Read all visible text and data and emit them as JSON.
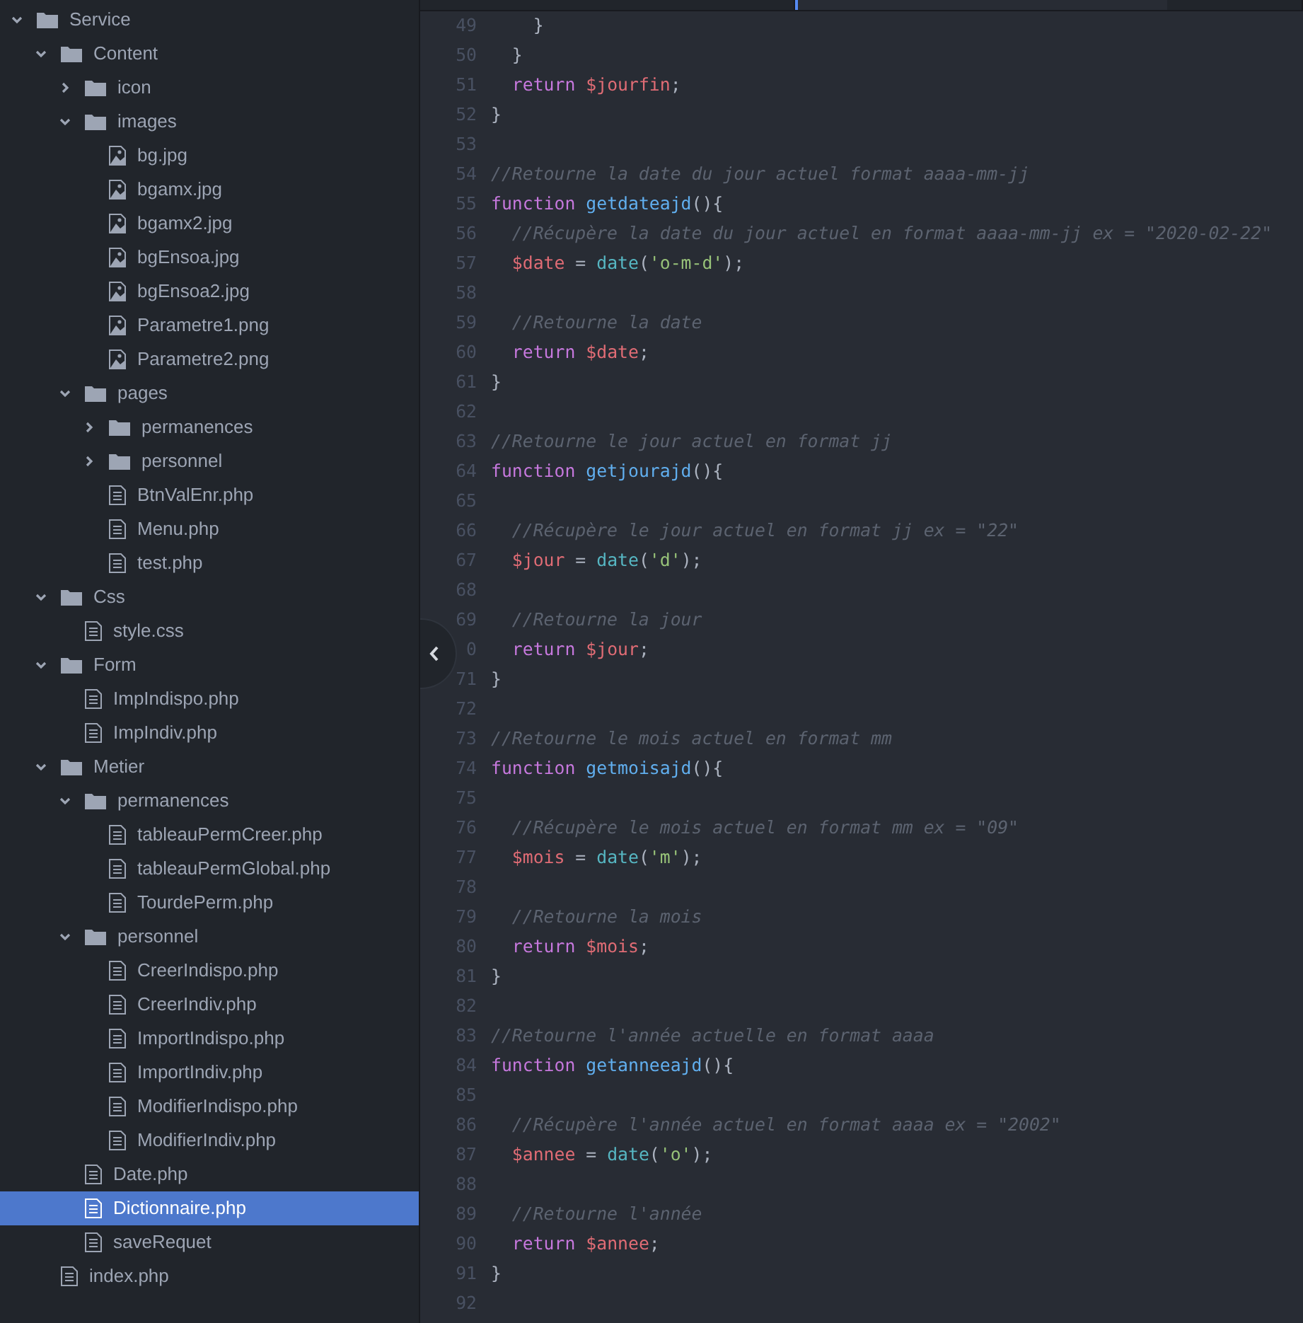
{
  "tabs": [
    {
      "selected": false
    },
    {
      "selected": true
    },
    {
      "selected": false
    }
  ],
  "tree": [
    {
      "kind": "folder",
      "name": "Service",
      "expanded": true,
      "selected": false,
      "children": [
        {
          "kind": "folder",
          "name": "Content",
          "expanded": true,
          "selected": false,
          "children": [
            {
              "kind": "folder",
              "name": "icon",
              "expanded": false,
              "selected": false
            },
            {
              "kind": "folder",
              "name": "images",
              "expanded": true,
              "selected": false,
              "children": [
                {
                  "kind": "image",
                  "name": "bg.jpg",
                  "selected": false
                },
                {
                  "kind": "image",
                  "name": "bgamx.jpg",
                  "selected": false
                },
                {
                  "kind": "image",
                  "name": "bgamx2.jpg",
                  "selected": false
                },
                {
                  "kind": "image",
                  "name": "bgEnsoa.jpg",
                  "selected": false
                },
                {
                  "kind": "image",
                  "name": "bgEnsoa2.jpg",
                  "selected": false
                },
                {
                  "kind": "image",
                  "name": "Parametre1.png",
                  "selected": false
                },
                {
                  "kind": "image",
                  "name": "Parametre2.png",
                  "selected": false
                }
              ]
            },
            {
              "kind": "folder",
              "name": "pages",
              "expanded": true,
              "selected": false,
              "children": [
                {
                  "kind": "folder",
                  "name": "permanences",
                  "expanded": false,
                  "selected": false
                },
                {
                  "kind": "folder",
                  "name": "personnel",
                  "expanded": false,
                  "selected": false
                },
                {
                  "kind": "file",
                  "name": "BtnValEnr.php",
                  "selected": false
                },
                {
                  "kind": "file",
                  "name": "Menu.php",
                  "selected": false
                },
                {
                  "kind": "file",
                  "name": "test.php",
                  "selected": false
                }
              ]
            }
          ]
        },
        {
          "kind": "folder",
          "name": "Css",
          "expanded": true,
          "selected": false,
          "children": [
            {
              "kind": "file",
              "name": "style.css",
              "selected": false
            }
          ]
        },
        {
          "kind": "folder",
          "name": "Form",
          "expanded": true,
          "selected": false,
          "children": [
            {
              "kind": "file",
              "name": "ImpIndispo.php",
              "selected": false
            },
            {
              "kind": "file",
              "name": "ImpIndiv.php",
              "selected": false
            }
          ]
        },
        {
          "kind": "folder",
          "name": "Metier",
          "expanded": true,
          "selected": false,
          "children": [
            {
              "kind": "folder",
              "name": "permanences",
              "expanded": true,
              "selected": false,
              "children": [
                {
                  "kind": "file",
                  "name": "tableauPermCreer.php",
                  "selected": false
                },
                {
                  "kind": "file",
                  "name": "tableauPermGlobal.php",
                  "selected": false
                },
                {
                  "kind": "file",
                  "name": "TourdePerm.php",
                  "selected": false
                }
              ]
            },
            {
              "kind": "folder",
              "name": "personnel",
              "expanded": true,
              "selected": false,
              "children": [
                {
                  "kind": "file",
                  "name": "CreerIndispo.php",
                  "selected": false
                },
                {
                  "kind": "file",
                  "name": "CreerIndiv.php",
                  "selected": false
                },
                {
                  "kind": "file",
                  "name": "ImportIndispo.php",
                  "selected": false
                },
                {
                  "kind": "file",
                  "name": "ImportIndiv.php",
                  "selected": false
                },
                {
                  "kind": "file",
                  "name": "ModifierIndispo.php",
                  "selected": false
                },
                {
                  "kind": "file",
                  "name": "ModifierIndiv.php",
                  "selected": false
                }
              ]
            },
            {
              "kind": "file",
              "name": "Date.php",
              "selected": false
            },
            {
              "kind": "file",
              "name": "Dictionnaire.php",
              "selected": true
            },
            {
              "kind": "file",
              "name": "saveRequet",
              "selected": false
            }
          ]
        },
        {
          "kind": "file",
          "name": "index.php",
          "selected": false
        }
      ]
    }
  ],
  "code": [
    {
      "number": "49",
      "tokens": [
        {
          "kind": "plain",
          "text": "    }"
        }
      ]
    },
    {
      "number": "50",
      "tokens": [
        {
          "kind": "plain",
          "text": "  }"
        }
      ]
    },
    {
      "number": "51",
      "tokens": [
        {
          "kind": "keyword",
          "text": "  return"
        },
        {
          "kind": "variable",
          "text": " $jourfin"
        },
        {
          "kind": "plain",
          "text": ";"
        }
      ]
    },
    {
      "number": "52",
      "tokens": [
        {
          "kind": "plain",
          "text": "}"
        }
      ]
    },
    {
      "number": "53"
    },
    {
      "number": "54",
      "tokens": [
        {
          "kind": "comment",
          "text": "//Retourne la date du jour actuel format aaaa-mm-jj"
        }
      ]
    },
    {
      "number": "55",
      "tokens": [
        {
          "kind": "keyword",
          "text": "function"
        },
        {
          "kind": "function",
          "text": " getdateajd"
        },
        {
          "kind": "plain",
          "text": "(){"
        }
      ]
    },
    {
      "number": "56",
      "tokens": [
        {
          "kind": "comment",
          "text": "  //Récupère la date du jour actuel en format aaaa-mm-jj ex = \"2020-02-22\""
        }
      ]
    },
    {
      "number": "57",
      "tokens": [
        {
          "kind": "variable",
          "text": "  $date"
        },
        {
          "kind": "plain",
          "text": " = "
        },
        {
          "kind": "builtin",
          "text": "date"
        },
        {
          "kind": "plain",
          "text": "("
        },
        {
          "kind": "string",
          "text": "'o-m-d'"
        },
        {
          "kind": "plain",
          "text": ");"
        }
      ]
    },
    {
      "number": "58"
    },
    {
      "number": "59",
      "tokens": [
        {
          "kind": "comment",
          "text": "  //Retourne la date"
        }
      ]
    },
    {
      "number": "60",
      "tokens": [
        {
          "kind": "keyword",
          "text": "  return"
        },
        {
          "kind": "variable",
          "text": " $date"
        },
        {
          "kind": "plain",
          "text": ";"
        }
      ]
    },
    {
      "number": "61",
      "tokens": [
        {
          "kind": "plain",
          "text": "}"
        }
      ]
    },
    {
      "number": "62"
    },
    {
      "number": "63",
      "tokens": [
        {
          "kind": "comment",
          "text": "//Retourne le jour actuel en format jj"
        }
      ]
    },
    {
      "number": "64",
      "tokens": [
        {
          "kind": "keyword",
          "text": "function"
        },
        {
          "kind": "function",
          "text": " getjourajd"
        },
        {
          "kind": "plain",
          "text": "(){"
        }
      ]
    },
    {
      "number": "65"
    },
    {
      "number": "66",
      "tokens": [
        {
          "kind": "comment",
          "text": "  //Récupère le jour actuel en format jj ex = \"22\""
        }
      ]
    },
    {
      "number": "67",
      "tokens": [
        {
          "kind": "variable",
          "text": "  $jour"
        },
        {
          "kind": "plain",
          "text": " = "
        },
        {
          "kind": "builtin",
          "text": "date"
        },
        {
          "kind": "plain",
          "text": "("
        },
        {
          "kind": "string",
          "text": "'d'"
        },
        {
          "kind": "plain",
          "text": ");"
        }
      ]
    },
    {
      "number": "68"
    },
    {
      "number": "69",
      "tokens": [
        {
          "kind": "comment",
          "text": "  //Retourne la jour"
        }
      ]
    },
    {
      "number": "0",
      "tokens": [
        {
          "kind": "keyword",
          "text": "  return"
        },
        {
          "kind": "variable",
          "text": " $jour"
        },
        {
          "kind": "plain",
          "text": ";"
        }
      ]
    },
    {
      "number": "71",
      "tokens": [
        {
          "kind": "plain",
          "text": "}"
        }
      ]
    },
    {
      "number": "72"
    },
    {
      "number": "73",
      "tokens": [
        {
          "kind": "comment",
          "text": "//Retourne le mois actuel en format mm"
        }
      ]
    },
    {
      "number": "74",
      "tokens": [
        {
          "kind": "keyword",
          "text": "function"
        },
        {
          "kind": "function",
          "text": " getmoisajd"
        },
        {
          "kind": "plain",
          "text": "(){"
        }
      ]
    },
    {
      "number": "75"
    },
    {
      "number": "76",
      "tokens": [
        {
          "kind": "comment",
          "text": "  //Récupère le mois actuel en format mm ex = \"09\""
        }
      ]
    },
    {
      "number": "77",
      "tokens": [
        {
          "kind": "variable",
          "text": "  $mois"
        },
        {
          "kind": "plain",
          "text": " = "
        },
        {
          "kind": "builtin",
          "text": "date"
        },
        {
          "kind": "plain",
          "text": "("
        },
        {
          "kind": "string",
          "text": "'m'"
        },
        {
          "kind": "plain",
          "text": ");"
        }
      ]
    },
    {
      "number": "78"
    },
    {
      "number": "79",
      "tokens": [
        {
          "kind": "comment",
          "text": "  //Retourne la mois"
        }
      ]
    },
    {
      "number": "80",
      "tokens": [
        {
          "kind": "keyword",
          "text": "  return"
        },
        {
          "kind": "variable",
          "text": " $mois"
        },
        {
          "kind": "plain",
          "text": ";"
        }
      ]
    },
    {
      "number": "81",
      "tokens": [
        {
          "kind": "plain",
          "text": "}"
        }
      ]
    },
    {
      "number": "82"
    },
    {
      "number": "83",
      "tokens": [
        {
          "kind": "comment",
          "text": "//Retourne l'année actuelle en format aaaa"
        }
      ]
    },
    {
      "number": "84",
      "tokens": [
        {
          "kind": "keyword",
          "text": "function"
        },
        {
          "kind": "function",
          "text": " getanneeajd"
        },
        {
          "kind": "plain",
          "text": "(){"
        }
      ]
    },
    {
      "number": "85"
    },
    {
      "number": "86",
      "tokens": [
        {
          "kind": "comment",
          "text": "  //Récupère l'année actuel en format aaaa ex = \"2002\""
        }
      ]
    },
    {
      "number": "87",
      "tokens": [
        {
          "kind": "variable",
          "text": "  $annee"
        },
        {
          "kind": "plain",
          "text": " = "
        },
        {
          "kind": "builtin",
          "text": "date"
        },
        {
          "kind": "plain",
          "text": "("
        },
        {
          "kind": "string",
          "text": "'o'"
        },
        {
          "kind": "plain",
          "text": ");"
        }
      ]
    },
    {
      "number": "88"
    },
    {
      "number": "89",
      "tokens": [
        {
          "kind": "comment",
          "text": "  //Retourne l'année"
        }
      ]
    },
    {
      "number": "90",
      "tokens": [
        {
          "kind": "keyword",
          "text": "  return"
        },
        {
          "kind": "variable",
          "text": " $annee"
        },
        {
          "kind": "plain",
          "text": ";"
        }
      ]
    },
    {
      "number": "91",
      "tokens": [
        {
          "kind": "plain",
          "text": "}"
        }
      ]
    },
    {
      "number": "92"
    }
  ]
}
